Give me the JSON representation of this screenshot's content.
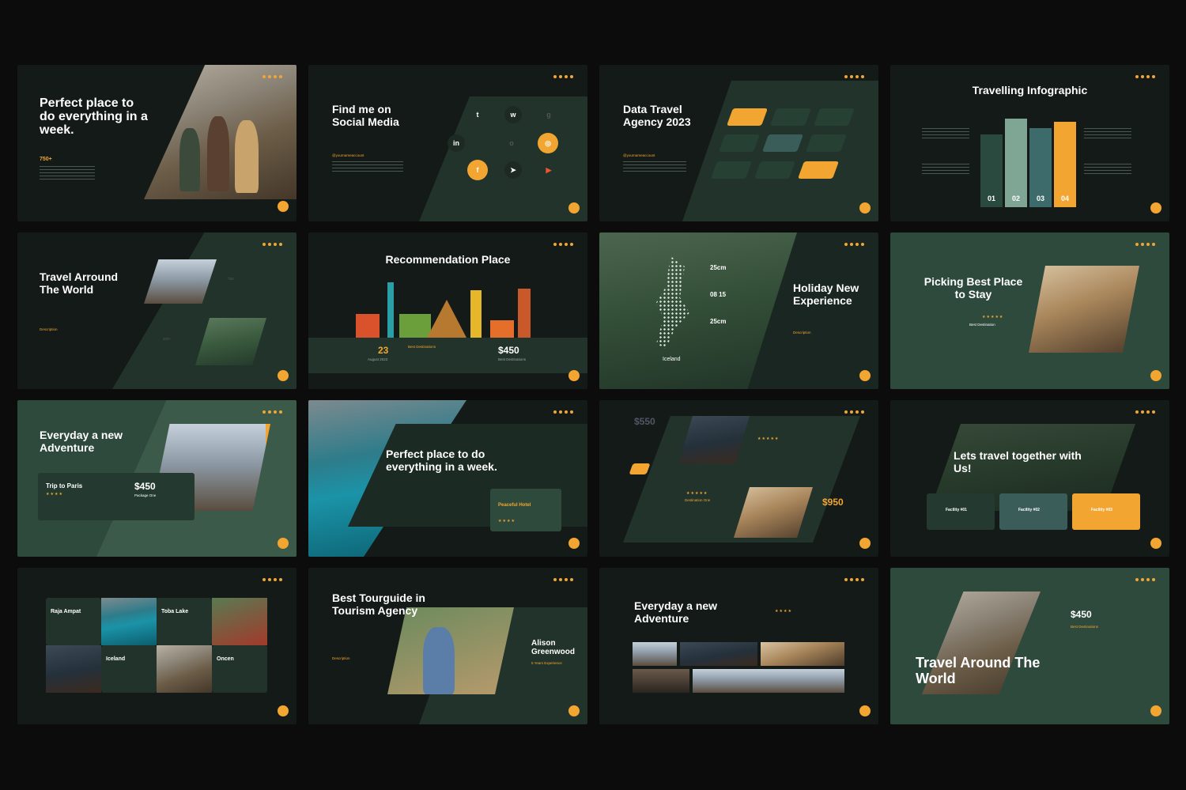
{
  "slides": {
    "s1": {
      "title": "Perfect place to do everything in a week.",
      "stat": "750+"
    },
    "s2": {
      "title": "Find me on Social Media",
      "handle": "@yournameaccount"
    },
    "s3": {
      "title": "Data Travel Agency 2023",
      "handle": "@yournameaccount"
    },
    "s4": {
      "title": "Travelling Infographic",
      "bars": [
        "01",
        "02",
        "03",
        "04"
      ]
    },
    "s5": {
      "title": "Travel Arround The World",
      "description": "Description",
      "stat1": "750",
      "stat2": "250+"
    },
    "s6": {
      "title": "Recommendation Place",
      "date_num": "23",
      "date_label": "August 2023",
      "best": "Best Destinations",
      "price": "$450",
      "price_label": "Best Destinations"
    },
    "s7": {
      "title": "Holiday New Experience",
      "description": "Description",
      "iceland": "Iceland",
      "m1": "25cm",
      "m2": "08 15",
      "m3": "25cm"
    },
    "s8": {
      "title": "Picking Best Place to Stay",
      "best": "Best Destination"
    },
    "s9": {
      "title": "Everyday a new Adventure",
      "trip": "Trip to Paris",
      "price": "$450",
      "package": "Package One"
    },
    "s10": {
      "title": "Perfect place to do everything in a week.",
      "hotel": "Peaceful Hotel"
    },
    "s11": {
      "price1": "$550",
      "price2": "$950",
      "dest": "Destination One"
    },
    "s12": {
      "title": "Lets travel together with Us!",
      "f1": "Facility #01",
      "f2": "Facility #02",
      "f3": "Facility #03"
    },
    "s13": {
      "p1": "Raja Ampat",
      "p2": "Toba Lake",
      "p3": "Iceland",
      "p4": "Oncen"
    },
    "s14": {
      "title": "Best Tourguide in Tourism Agency",
      "description": "Description",
      "name": "Alison Greenwood",
      "exp": "5 Years Experience"
    },
    "s15": {
      "title": "Everyday a new Adventure"
    },
    "s16": {
      "title": "Travel Around The World",
      "price": "$450",
      "best": "Best Destinations"
    }
  },
  "colors": {
    "accent": "#f2a631",
    "dark": "#131a17",
    "green": "#2e4a3c"
  }
}
